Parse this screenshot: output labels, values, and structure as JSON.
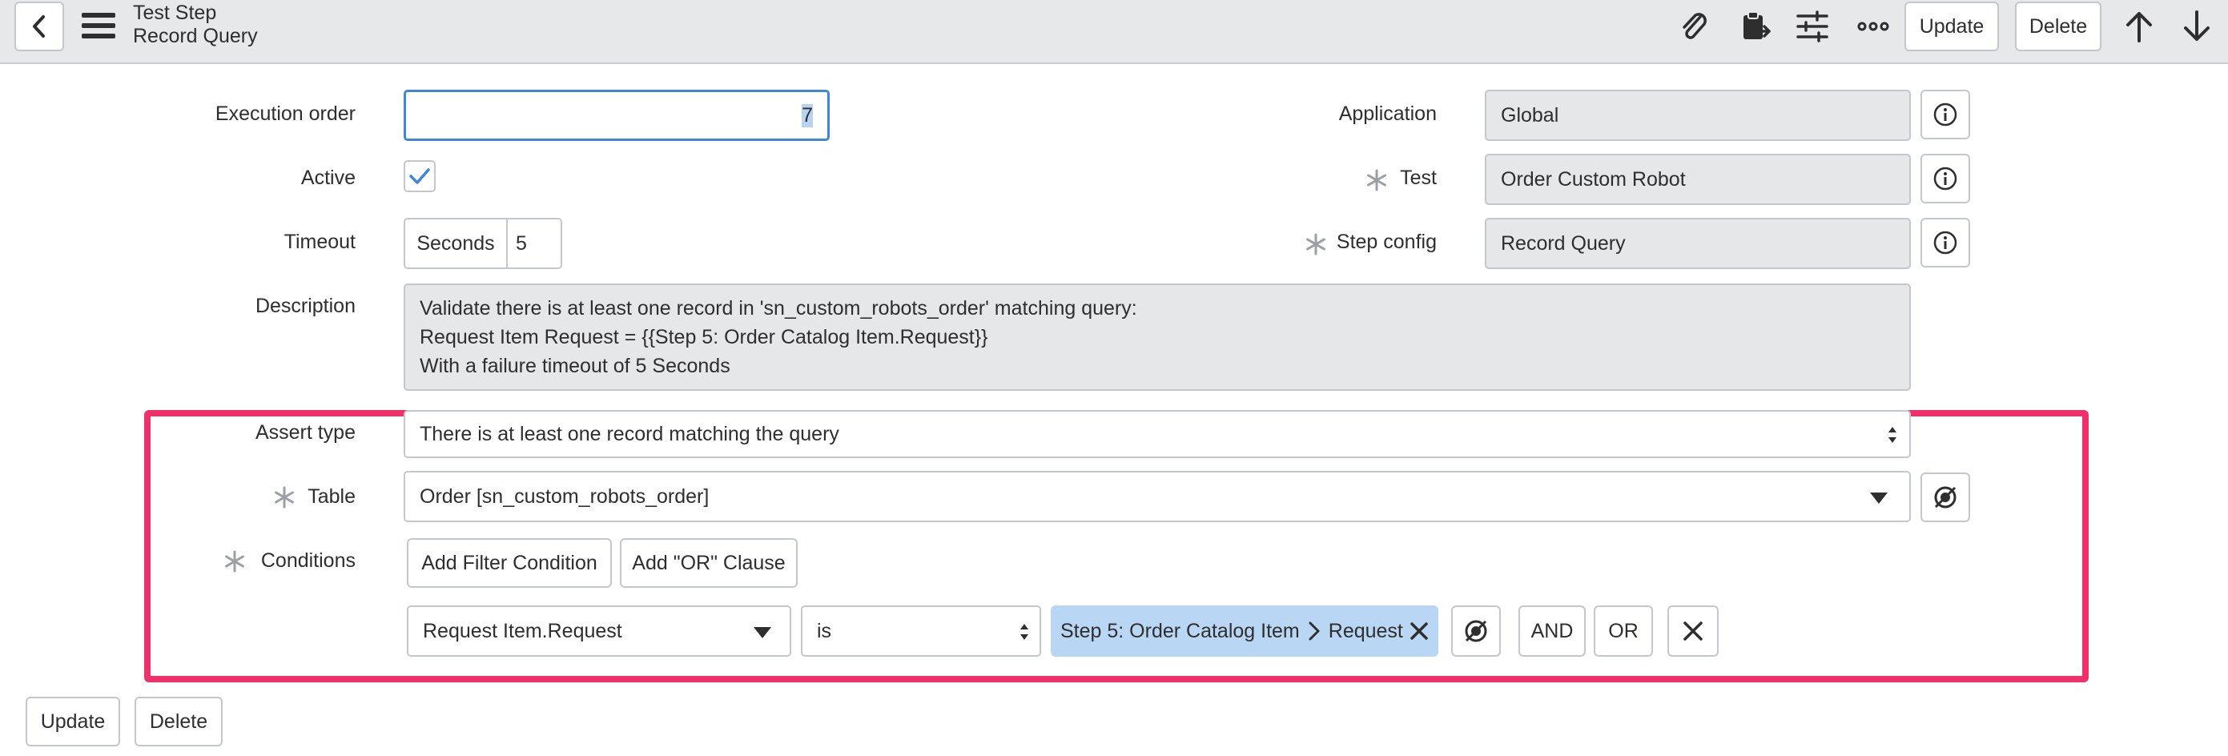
{
  "header": {
    "title_line1": "Test Step",
    "title_line2": "Record Query",
    "update_label": "Update",
    "delete_label": "Delete",
    "icons": [
      "back-icon",
      "menu-icon",
      "paperclip-icon",
      "clipboard-icon",
      "settings-sliders-icon",
      "more-icon",
      "arrow-up-icon",
      "arrow-down-icon"
    ]
  },
  "form": {
    "execution_order": {
      "label": "Execution order",
      "value": "7"
    },
    "active": {
      "label": "Active",
      "checked": true
    },
    "timeout": {
      "label": "Timeout",
      "unit": "Seconds",
      "value": "5"
    },
    "description": {
      "label": "Description",
      "lines": [
        "Validate there is at least one record in 'sn_custom_robots_order' matching query:",
        "Request Item Request = {{Step 5: Order Catalog Item.Request}}",
        "With a failure timeout of 5 Seconds"
      ]
    },
    "application": {
      "label": "Application",
      "value": "Global"
    },
    "test": {
      "label": "Test",
      "value": "Order Custom Robot"
    },
    "step_config": {
      "label": "Step config",
      "value": "Record Query"
    },
    "assert_type": {
      "label": "Assert type",
      "value": "There is at least one record matching the query"
    },
    "table": {
      "label": "Table",
      "value": "Order [sn_custom_robots_order]"
    },
    "conditions": {
      "label": "Conditions",
      "add_filter_label": "Add Filter Condition",
      "add_or_label": "Add \"OR\" Clause",
      "field": "Request Item.Request",
      "operator": "is",
      "value_part1": "Step 5: Order Catalog Item",
      "value_part2": "Request",
      "and_label": "AND",
      "or_label": "OR"
    }
  },
  "footer": {
    "update_label": "Update",
    "delete_label": "Delete"
  },
  "colors": {
    "header_bg": "#e6e8ea",
    "highlight": "#f0306a",
    "tag_bg": "#b9d7f4",
    "focus": "#3f86d8"
  }
}
